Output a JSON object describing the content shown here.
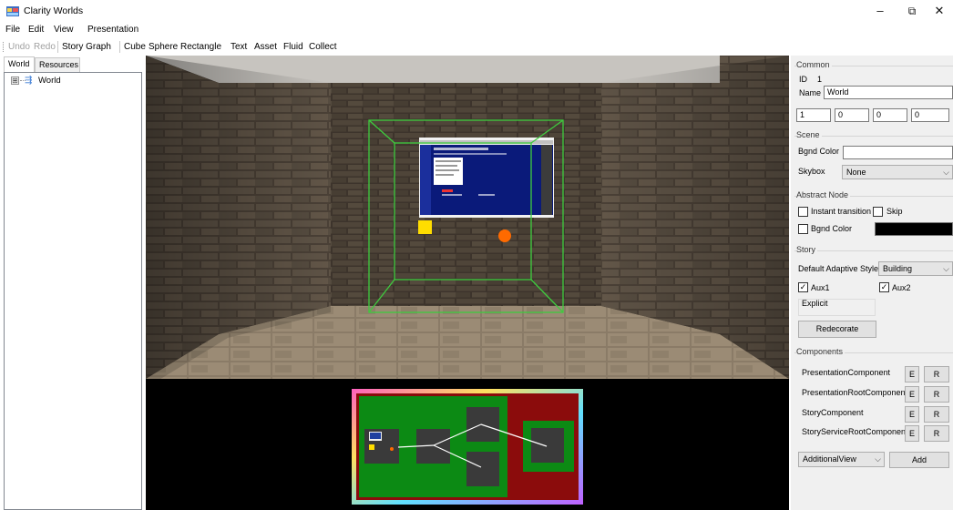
{
  "window": {
    "title": "Clarity Worlds",
    "minimize_glyph": "–",
    "maximize_glyph": "⧉",
    "close_glyph": "✕"
  },
  "menu": [
    "File",
    "Edit",
    "View",
    "Presentation"
  ],
  "toolbar": {
    "undo": "Undo",
    "redo": "Redo",
    "story_graph": "Story Graph",
    "cube": "Cube",
    "sphere": "Sphere",
    "rectangle": "Rectangle",
    "text": "Text",
    "asset": "Asset",
    "fluid": "Fluid",
    "collect": "Collect"
  },
  "left_tabs": [
    "World",
    "Resources"
  ],
  "tree": {
    "expander": "⊞",
    "root": "World",
    "icon": "world-icon"
  },
  "props": {
    "common": {
      "header": "Common",
      "id_label": "ID",
      "id_value": "1",
      "name_label": "Name",
      "name_value": "World",
      "vec": [
        "1",
        "0",
        "0",
        "0"
      ]
    },
    "scene": {
      "header": "Scene",
      "bgnd_label": "Bgnd Color",
      "skybox_label": "Skybox",
      "skybox_value": "None"
    },
    "abstract": {
      "header": "Abstract Node",
      "instant_label": "Instant transition",
      "skip_label": "Skip",
      "bgnd_label": "Bgnd Color",
      "bgnd_color": "#000000"
    },
    "story": {
      "header": "Story",
      "style_label": "Default Adaptive Style",
      "style_value": "Building",
      "aux1": "Aux1",
      "aux2": "Aux2",
      "check_glyph": "✓",
      "explicit": "Explicit",
      "redecorate": "Redecorate"
    },
    "components": {
      "header": "Components",
      "items": [
        "PresentationComponent",
        "PresentationRootComponent",
        "StoryComponent",
        "StoryServiceRootComponent"
      ],
      "e_label": "E",
      "r_label": "R",
      "add_view": "AdditionalView",
      "add": "Add"
    }
  },
  "colors": {
    "wireframe": "#3ecb3e",
    "graph_green": "#0c8a14",
    "graph_red": "#8b0c0c",
    "sphere": "#ff6a00",
    "cube": "#ffdd00",
    "screen_blue": "#0a1a7a"
  }
}
